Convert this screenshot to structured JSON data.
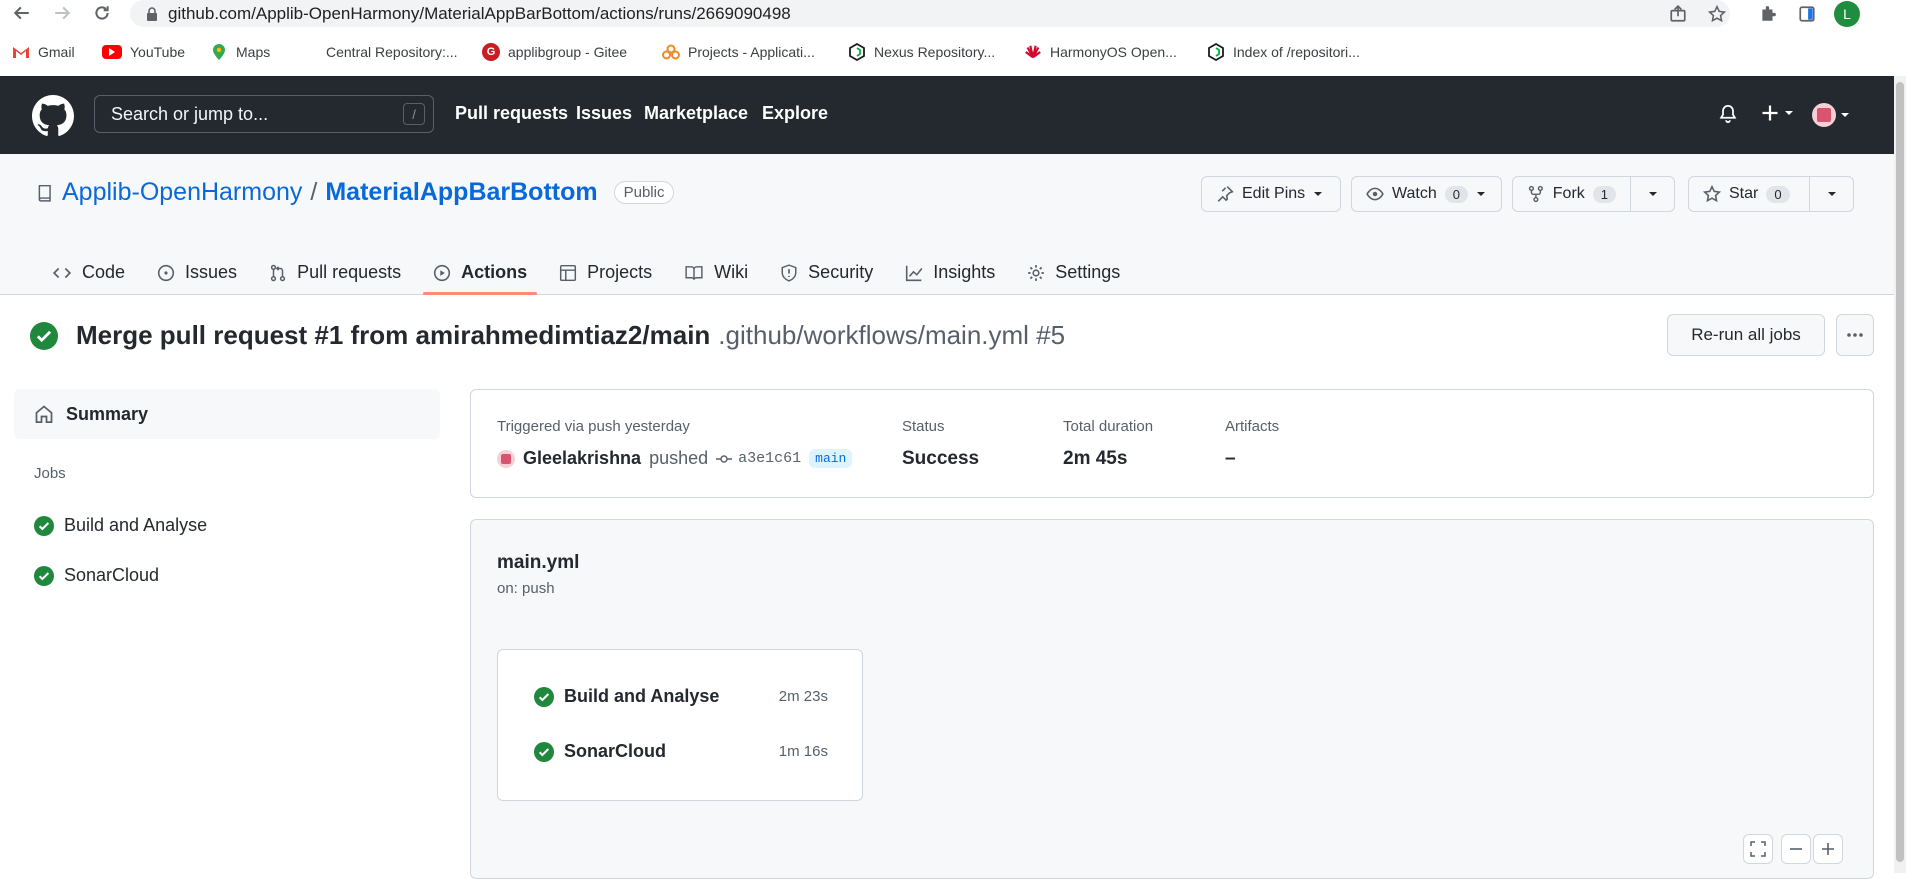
{
  "browser": {
    "url": "github.com/Applib-OpenHarmony/MaterialAppBarBottom/actions/runs/2669090498",
    "profile_initial": "L",
    "bookmarks": [
      {
        "label": "Gmail",
        "icon": "gmail-icon",
        "color": "#ea4335"
      },
      {
        "label": "YouTube",
        "icon": "youtube-icon",
        "color": "#ff0000"
      },
      {
        "label": "Maps",
        "icon": "maps-icon",
        "color": "#34a853"
      },
      {
        "label": "Central Repository:...",
        "icon": "central-repo-icon",
        "color": "#ffffff"
      },
      {
        "label": "applibgroup - Gitee",
        "icon": "gitee-icon",
        "color": "#c71d23"
      },
      {
        "label": "Projects - Applicati...",
        "icon": "projects-cloud-icon",
        "color": "#f08a24"
      },
      {
        "label": "Nexus Repository...",
        "icon": "nexus-icon",
        "color": "#1b1c1d"
      },
      {
        "label": "HarmonyOS Open...",
        "icon": "huawei-icon",
        "color": "#cf0a2c"
      },
      {
        "label": "Index of /repositori...",
        "icon": "nexus-icon",
        "color": "#1b1c1d"
      }
    ]
  },
  "github": {
    "search_placeholder": "Search or jump to...",
    "search_shortcut": "/",
    "nav": [
      "Pull requests",
      "Issues",
      "Marketplace",
      "Explore"
    ]
  },
  "repo": {
    "owner": "Applib-OpenHarmony",
    "separator": "/",
    "name": "MaterialAppBarBottom",
    "visibility": "Public",
    "edit_pins": "Edit Pins",
    "watch_label": "Watch",
    "watch_count": "0",
    "fork_label": "Fork",
    "fork_count": "1",
    "star_label": "Star",
    "star_count": "0",
    "tabs": [
      {
        "label": "Code",
        "icon": "code-icon"
      },
      {
        "label": "Issues",
        "icon": "issue-icon"
      },
      {
        "label": "Pull requests",
        "icon": "pull-request-icon"
      },
      {
        "label": "Actions",
        "icon": "play-icon",
        "active": true
      },
      {
        "label": "Projects",
        "icon": "table-icon"
      },
      {
        "label": "Wiki",
        "icon": "book-icon"
      },
      {
        "label": "Security",
        "icon": "shield-icon"
      },
      {
        "label": "Insights",
        "icon": "graph-icon"
      },
      {
        "label": "Settings",
        "icon": "gear-icon"
      }
    ]
  },
  "run": {
    "title": "Merge pull request #1 from amirahmedimtiaz2/main",
    "workflow_ref": ".github/workflows/main.yml #5",
    "rerun_label": "Re-run all jobs",
    "status_color": "#1f883d"
  },
  "sidebar": {
    "summary_label": "Summary",
    "jobs_label": "Jobs",
    "jobs": [
      "Build and Analyse",
      "SonarCloud"
    ]
  },
  "summary": {
    "trigger_label": "Triggered via push yesterday",
    "actor": "Gleelakrishna",
    "action": "pushed",
    "sha": "a3e1c61",
    "branch": "main",
    "status_label": "Status",
    "status_value": "Success",
    "duration_label": "Total duration",
    "duration_value": "2m 45s",
    "artifacts_label": "Artifacts",
    "artifacts_value": "–"
  },
  "workflow": {
    "file": "main.yml",
    "trigger": "on: push",
    "jobs": [
      {
        "name": "Build and Analyse",
        "duration": "2m 23s"
      },
      {
        "name": "SonarCloud",
        "duration": "1m 16s"
      }
    ]
  }
}
